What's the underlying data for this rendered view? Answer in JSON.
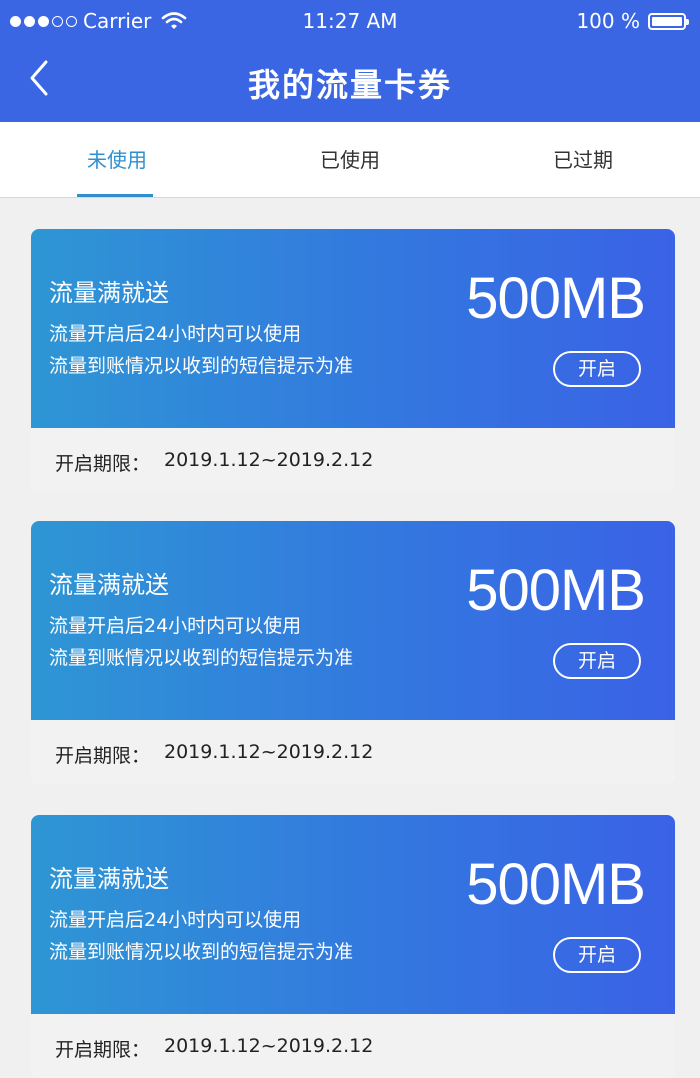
{
  "status_bar": {
    "carrier": "Carrier",
    "time": "11:27 AM",
    "battery": "100 %"
  },
  "header": {
    "title": "我的流量卡券"
  },
  "tabs": [
    {
      "label": "未使用",
      "active": true
    },
    {
      "label": "已使用",
      "active": false
    },
    {
      "label": "已过期",
      "active": false
    }
  ],
  "coupons": [
    {
      "title": "流量满就送",
      "line1": "流量开启后24小时内可以使用",
      "line2": "流量到账情况以收到的短信提示为准",
      "amount": "500MB",
      "button_label": "开启",
      "period_label": "开启期限：",
      "period_value": "2019.1.12~2019.2.12"
    },
    {
      "title": "流量满就送",
      "line1": "流量开启后24小时内可以使用",
      "line2": "流量到账情况以收到的短信提示为准",
      "amount": "500MB",
      "button_label": "开启",
      "period_label": "开启期限：",
      "period_value": "2019.1.12~2019.2.12"
    },
    {
      "title": "流量满就送",
      "line1": "流量开启后24小时内可以使用",
      "line2": "流量到账情况以收到的短信提示为准",
      "amount": "500MB",
      "button_label": "开启",
      "period_label": "开启期限：",
      "period_value": "2019.1.12~2019.2.12"
    }
  ],
  "colors": {
    "header_bg": "#3a66e3",
    "tab_active": "#2f8fcf",
    "card_gradient_start": "#2e96d4",
    "card_gradient_end": "#3a62e6"
  }
}
